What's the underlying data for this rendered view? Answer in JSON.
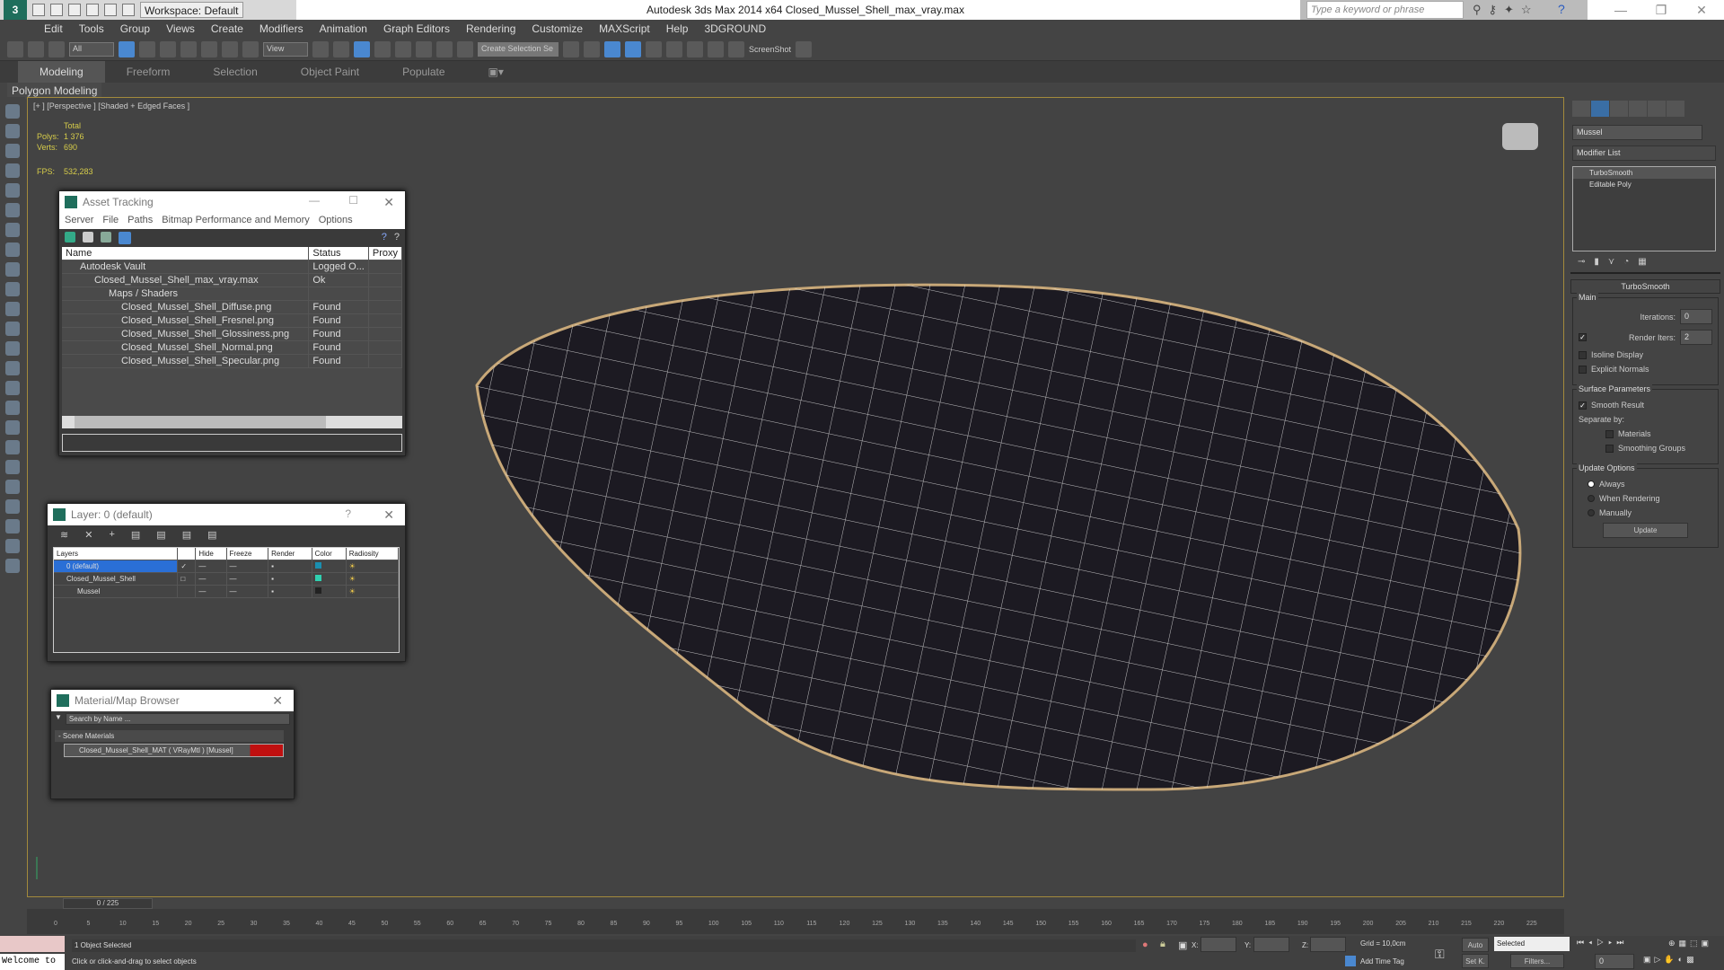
{
  "titlebar": {
    "workspace": "Workspace: Default",
    "title": "Autodesk 3ds Max  2014 x64     Closed_Mussel_Shell_max_vray.max",
    "search_placeholder": "Type a keyword or phrase"
  },
  "menu": [
    "Edit",
    "Tools",
    "Group",
    "Views",
    "Create",
    "Modifiers",
    "Animation",
    "Graph Editors",
    "Rendering",
    "Customize",
    "MAXScript",
    "Help",
    "3DGROUND"
  ],
  "toolbar": {
    "filter": "All",
    "refcoord": "View",
    "selset": "Create Selection Se",
    "screenshot": "ScreenShot"
  },
  "ribbon": {
    "tabs": [
      "Modeling",
      "Freeform",
      "Selection",
      "Object Paint",
      "Populate"
    ],
    "active": "Modeling",
    "panel": "Polygon Modeling"
  },
  "viewport": {
    "label": "[+ ] [Perspective ] [Shaded + Edged Faces ]",
    "total": "Total",
    "polys_label": "Polys:",
    "polys": "1 376",
    "verts_label": "Verts:",
    "verts": "690",
    "fps_label": "FPS:",
    "fps": "532,283"
  },
  "asset_tracking": {
    "title": "Asset Tracking",
    "menu": [
      "Server",
      "File",
      "Paths",
      "Bitmap Performance and Memory",
      "Options"
    ],
    "columns": [
      "Name",
      "Status",
      "Proxy"
    ],
    "rows": [
      {
        "name": "Autodesk Vault",
        "status": "Logged O..."
      },
      {
        "name": "Closed_Mussel_Shell_max_vray.max",
        "status": "Ok"
      },
      {
        "name": "Maps / Shaders",
        "status": ""
      },
      {
        "name": "Closed_Mussel_Shell_Diffuse.png",
        "status": "Found"
      },
      {
        "name": "Closed_Mussel_Shell_Fresnel.png",
        "status": "Found"
      },
      {
        "name": "Closed_Mussel_Shell_Glossiness.png",
        "status": "Found"
      },
      {
        "name": "Closed_Mussel_Shell_Normal.png",
        "status": "Found"
      },
      {
        "name": "Closed_Mussel_Shell_Specular.png",
        "status": "Found"
      }
    ]
  },
  "layer_dialog": {
    "title": "Layer: 0 (default)",
    "help": "?",
    "columns": [
      "Layers",
      "",
      "Hide",
      "Freeze",
      "Render",
      "Color",
      "Radiosity"
    ],
    "rows": [
      {
        "name": "0 (default)",
        "color": "#1a8fb0"
      },
      {
        "name": "Closed_Mussel_Shell",
        "color": "#2fd0b0"
      },
      {
        "name": "Mussel",
        "color": "#222222"
      }
    ]
  },
  "material_browser": {
    "title": "Material/Map Browser",
    "search_placeholder": "Search by Name ...",
    "group": "- Scene Materials",
    "item": "Closed_Mussel_Shell_MAT ( VRayMtl ) [Mussel]"
  },
  "command_panel": {
    "object_name": "Mussel",
    "modifier_list": "Modifier List",
    "stack": [
      "TurboSmooth",
      "Editable Poly"
    ],
    "rollout": "TurboSmooth",
    "main": "Main",
    "iterations_label": "Iterations:",
    "iterations": "0",
    "render_iters_label": "Render Iters:",
    "render_iters": "2",
    "render_iters_checked": true,
    "isoline": "Isoline Display",
    "explicit": "Explicit Normals",
    "surface": "Surface Parameters",
    "smooth_result": "Smooth Result",
    "separate_by": "Separate by:",
    "materials": "Materials",
    "smoothing_groups": "Smoothing Groups",
    "update_options": "Update Options",
    "always": "Always",
    "when_rendering": "When Rendering",
    "manually": "Manually",
    "update": "Update"
  },
  "timeline": {
    "position": "0 / 225",
    "start": 0,
    "end": 225,
    "step": 5
  },
  "status": {
    "maxscript": "Welcome to",
    "selected": "1 Object Selected",
    "prompt": "Click or click-and-drag to select objects",
    "x": "X:",
    "y": "Y:",
    "z": "Z:",
    "grid": "Grid = 10,0cm",
    "add_time_tag": "Add Time Tag",
    "auto": "Auto",
    "set_key": "Set K.",
    "key_filter": "Selected",
    "filters": "Filters...",
    "frame": "0"
  }
}
